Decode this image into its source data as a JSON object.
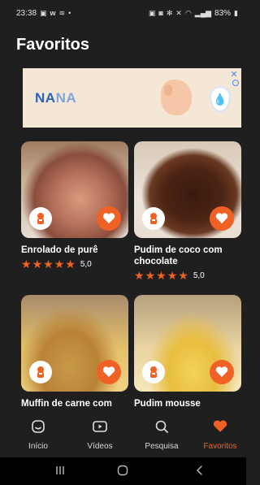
{
  "status_bar": {
    "time": "23:38",
    "left_icons": [
      "gallery-icon",
      "w-icon",
      "wifi-call-icon",
      "dot-icon"
    ],
    "battery": "83%"
  },
  "page_title": "Favoritos",
  "ad": {
    "brand_part1": "NA",
    "brand_part2": "NA",
    "close_label": "✕"
  },
  "recipes": [
    {
      "title": "Enrolado de purê",
      "rating": "5,0",
      "stars": 5,
      "favorited": true
    },
    {
      "title": "Pudim de coco com chocolate",
      "rating": "5,0",
      "stars": 5,
      "favorited": true
    },
    {
      "title": "Muffin de carne com",
      "favorited": true
    },
    {
      "title": "Pudim mousse",
      "favorited": true
    }
  ],
  "bottom_nav": [
    {
      "label": "Início",
      "icon": "home-icon",
      "active": false
    },
    {
      "label": "Vídeos",
      "icon": "video-icon",
      "active": false
    },
    {
      "label": "Pesquisa",
      "icon": "search-icon",
      "active": false
    },
    {
      "label": "Favoritos",
      "icon": "heart-icon",
      "active": true
    }
  ],
  "colors": {
    "accent": "#f06125",
    "background": "#1f1f1f"
  }
}
